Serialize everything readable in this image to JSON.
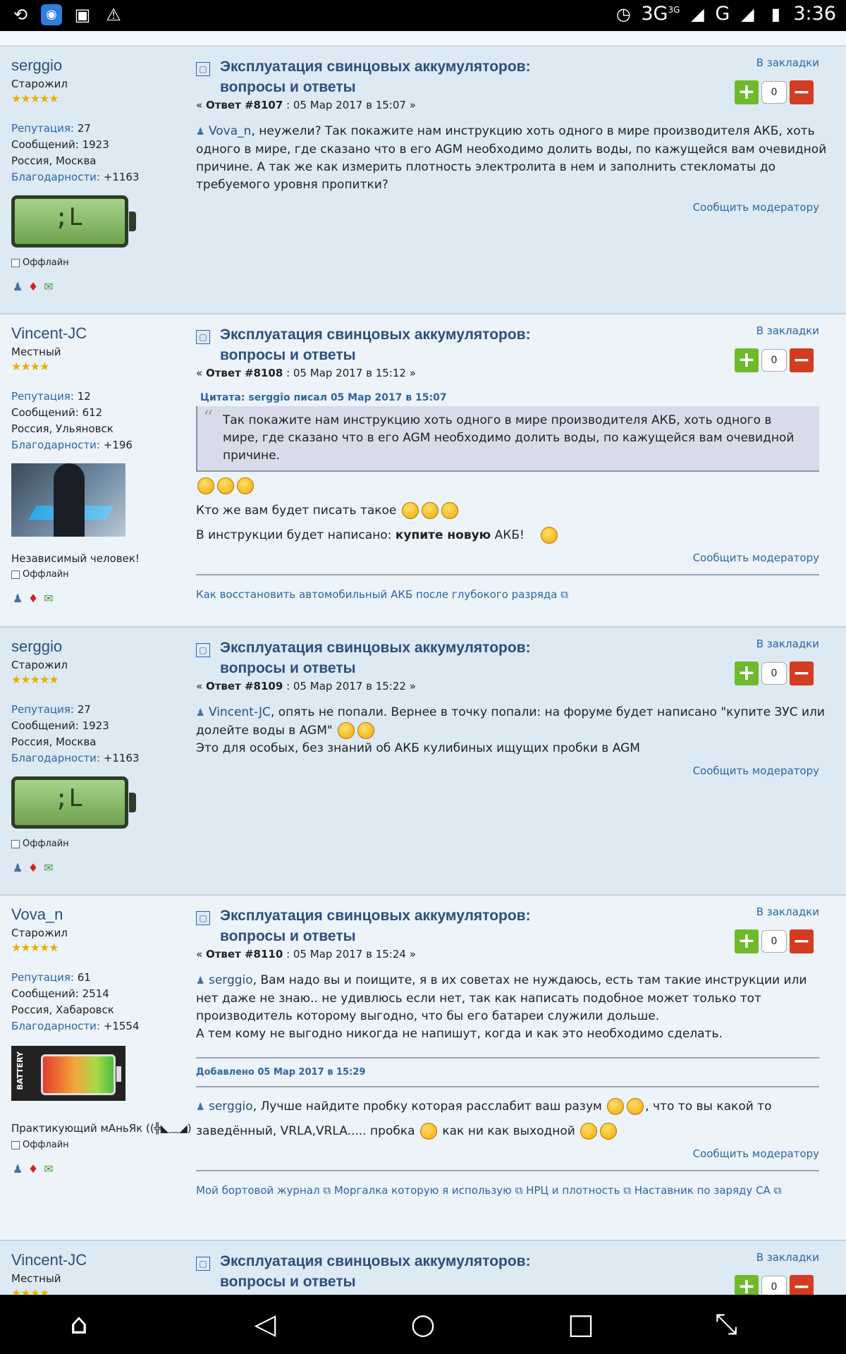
{
  "status_bar": {
    "network": "3G",
    "network_sup": "3G",
    "network2": "G",
    "time": "3:36"
  },
  "posts": [
    {
      "author": "serggio",
      "rank": "Старожил",
      "stars": "★★★★★",
      "rep_label": "Репутация:",
      "rep": "27",
      "msgs_label": "Сообщений:",
      "msgs": "1923",
      "location": "Россия, Москва",
      "thanks_label": "Благодарности:",
      "thanks": "+1163",
      "offline": "Оффлайн",
      "title_1": "Эксплуатация свинцовых аккумуляторов:",
      "title_2": "вопросы и ответы",
      "bookmark": "В закладки",
      "vote_count": "0",
      "reply_no": "Ответ #8107",
      "date": "05 Мар 2017 в 15:07",
      "mention": "Vova_n",
      "text": ", неужели? Так покажите нам инструкцию хоть одного в мире производителя АКБ, хоть одного в мире, где сказано что в его AGM необходимо долить воды, по кажущейся вам очевидной причине. А так же как измерить плотность электролита в нем и заполнить стекломаты до требуемого уровня пропитки?",
      "report": "Сообщить модератору"
    },
    {
      "author": "Vincent-JC",
      "rank": "Местный",
      "stars": "★★★★",
      "rep_label": "Репутация:",
      "rep": "12",
      "msgs_label": "Сообщений:",
      "msgs": "612",
      "location": "Россия, Ульяновск",
      "thanks_label": "Благодарности:",
      "thanks": "+196",
      "tagline": "Независимый человек!",
      "offline": "Оффлайн",
      "title_1": "Эксплуатация свинцовых аккумуляторов:",
      "title_2": "вопросы и ответы",
      "bookmark": "В закладки",
      "vote_count": "0",
      "reply_no": "Ответ #8108",
      "date": "05 Мар 2017 в 15:12",
      "quote_header": "Цитата: serggio писал 05 Мар 2017 в 15:07",
      "quote": "Так покажите нам инструкцию хоть одного в мире производителя АКБ, хоть одного в мире, где сказано что в его AGM необходимо долить воды, по кажущейся вам очевидной причине.",
      "line1": "Кто же вам будет писать такое",
      "line2a": "В инструкции будет написано:",
      "line2b": "купите новую",
      "line2c": "АКБ!",
      "report": "Сообщить модератору",
      "sig": "Как восстановить автомобильный АКБ после глубокого разряда"
    },
    {
      "author": "serggio",
      "rank": "Старожил",
      "stars": "★★★★★",
      "rep_label": "Репутация:",
      "rep": "27",
      "msgs_label": "Сообщений:",
      "msgs": "1923",
      "location": "Россия, Москва",
      "thanks_label": "Благодарности:",
      "thanks": "+1163",
      "offline": "Оффлайн",
      "title_1": "Эксплуатация свинцовых аккумуляторов:",
      "title_2": "вопросы и ответы",
      "bookmark": "В закладки",
      "vote_count": "0",
      "reply_no": "Ответ #8109",
      "date": "05 Мар 2017 в 15:22",
      "mention": "Vincent-JC",
      "text": ", опять не попали. Вернее в точку попали: на форуме будет написано \"купите ЗУС или долейте воды в AGM\"",
      "text2": "Это для особых, без знаний об АКБ кулибиных ищущих пробки в AGM",
      "report": "Сообщить модератору"
    },
    {
      "author": "Vova_n",
      "rank": "Старожил",
      "stars": "★★★★★",
      "rep_label": "Репутация:",
      "rep": "61",
      "msgs_label": "Сообщений:",
      "msgs": "2514",
      "location": "Россия, Хабаровск",
      "thanks_label": "Благодарности:",
      "thanks": "+1554",
      "avatar_text": "BATTERY",
      "tagline": "Практикующий мАньЯк ((╬◣﹏◢)",
      "offline": "Оффлайн",
      "title_1": "Эксплуатация свинцовых аккумуляторов:",
      "title_2": "вопросы и ответы",
      "bookmark": "В закладки",
      "vote_count": "0",
      "reply_no": "Ответ #8110",
      "date": "05 Мар 2017 в 15:24",
      "mention": "serggio",
      "text": ", Вам надо вы и поищите, я в их советах не нуждаюсь, есть там такие инструкции или нет даже не знаю.. не удивлюсь если нет, так как написать подобное может только тот производитель которому выгодно, что бы его батареи служили дольше.",
      "text2": "А тем кому не выгодно никогда не напишут, когда и как это необходимо сделать.",
      "added": "Добавлено 05 Мар 2017 в 15:29",
      "mention2": "serggio",
      "text3a": ", Лучше найдите пробку которая расслабит ваш разум",
      "text3b": ", что то вы какой то заведённый, VRLA,VRLA..... пробка",
      "text3c": "как ни как выходной",
      "report": "Сообщить модератору",
      "sig_links": [
        "Мой бортовой журнал",
        "Моргалка которую я использую",
        "НРЦ и плотность",
        "Наставник по заряду СА"
      ]
    },
    {
      "author": "Vincent-JC",
      "rank": "Местный",
      "stars": "★★★★",
      "title_1": "Эксплуатация свинцовых аккумуляторов:",
      "title_2": "вопросы и ответы",
      "bookmark": "В закладки",
      "vote_count": "0"
    }
  ],
  "colors": {
    "link": "#2c66a0",
    "title": "#2c4f7a",
    "plus": "#6fb92c",
    "minus": "#d23c20"
  },
  "icons": [
    "sync-icon",
    "share-icon",
    "image-icon",
    "warning-icon",
    "alarm-icon",
    "signal-icon",
    "battery-icon",
    "home-icon",
    "back-icon",
    "circle-home-icon",
    "recents-icon",
    "fullscreen-icon"
  ]
}
